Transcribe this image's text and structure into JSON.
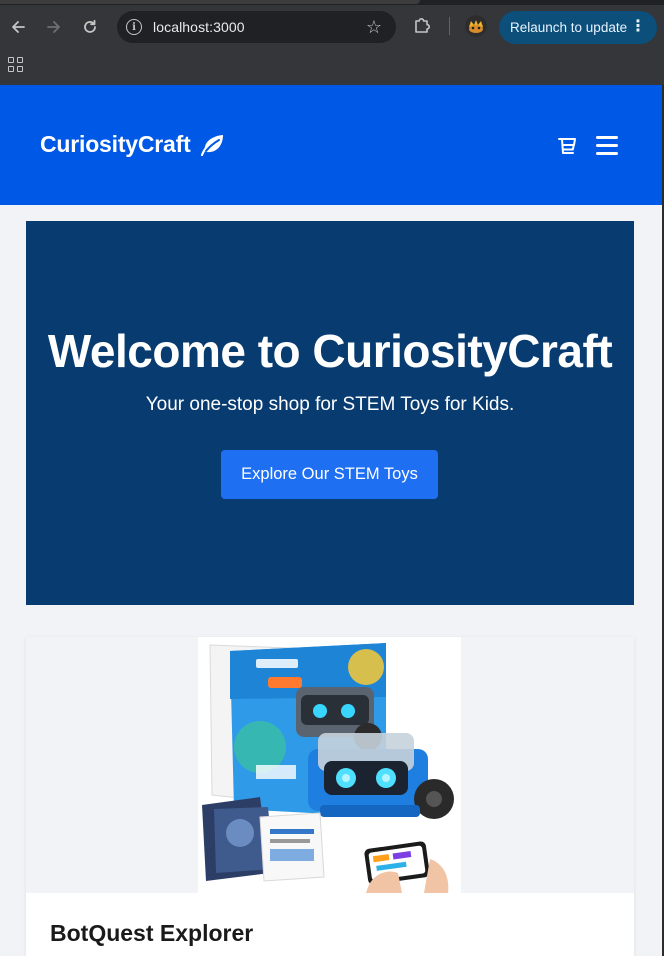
{
  "browser": {
    "url": "localhost:3000",
    "relaunch_label": "Relaunch to update",
    "icons": {
      "back": "arrow-left-icon",
      "forward": "arrow-right-icon",
      "reload": "reload-icon",
      "site_info": "info-icon",
      "bookmark": "star-icon",
      "extensions": "puzzle-icon",
      "profile": "avatar",
      "menu": "vertical-dots-icon",
      "apps": "apps-grid-icon"
    }
  },
  "header": {
    "brand": "CuriosityCraft",
    "background": "#0058e6",
    "icons": {
      "logo": "leaf-icon",
      "cart": "cart-icon",
      "menu": "hamburger-icon"
    }
  },
  "hero": {
    "title": "Welcome to CuriosityCraft",
    "subtitle": "Your one-stop shop for STEM Toys for Kids.",
    "cta_label": "Explore Our STEM Toys",
    "background": "#083c71",
    "button_color": "#1e6ff2"
  },
  "products": [
    {
      "name": "BotQuest Explorer",
      "image": "robot-kit-product-image"
    }
  ]
}
